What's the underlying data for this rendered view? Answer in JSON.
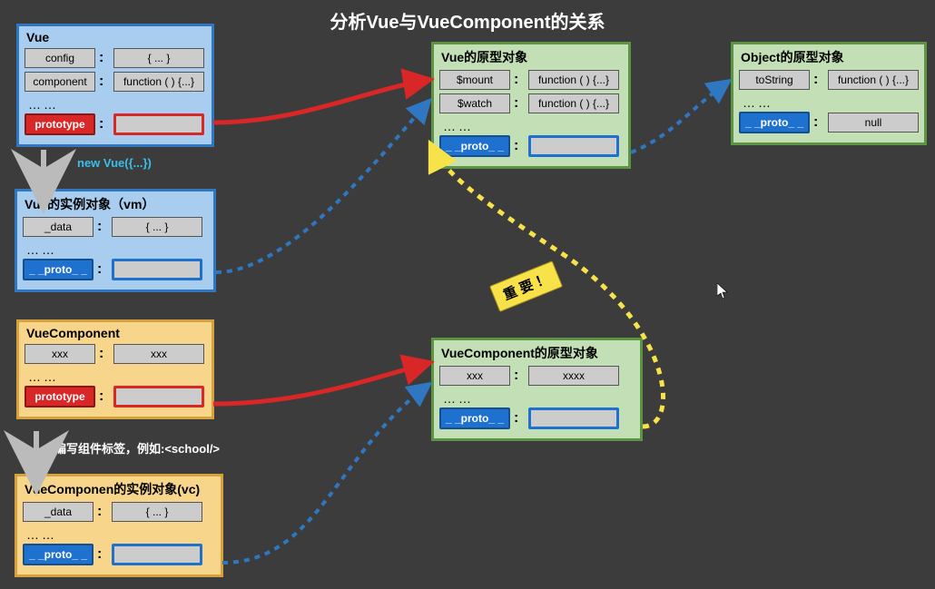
{
  "title": "分析Vue与VueComponent的关系",
  "boxes": {
    "vue": {
      "title": "Vue",
      "rows": [
        {
          "key": "config",
          "val": "{ ... }"
        },
        {
          "key": "component",
          "val": "function ( ) {...}"
        }
      ],
      "dots": "……",
      "proto_label": "prototype"
    },
    "vue_proto": {
      "title": "Vue的原型对象",
      "rows": [
        {
          "key": "$mount",
          "val": "function ( ) {...}"
        },
        {
          "key": "$watch",
          "val": "function ( ) {...}"
        }
      ],
      "dots": "……",
      "proto_label": "_ _proto_ _"
    },
    "obj_proto": {
      "title": "Object的原型对象",
      "rows": [
        {
          "key": "toString",
          "val": "function ( ) {...}"
        }
      ],
      "dots": "……",
      "proto_label": "_ _proto_ _",
      "proto_val": "null"
    },
    "vm": {
      "title": "Vue的实例对象（vm）",
      "rows": [
        {
          "key": "_data",
          "val": "{ ... }"
        }
      ],
      "dots": "……",
      "proto_label": "_ _proto_ _"
    },
    "vc_ctor": {
      "title": "VueComponent",
      "rows": [
        {
          "key": "xxx",
          "val": "xxx"
        }
      ],
      "dots": "……",
      "proto_label": "prototype"
    },
    "vc_proto": {
      "title": "VueComponent的原型对象",
      "rows": [
        {
          "key": "xxx",
          "val": "xxxx"
        }
      ],
      "dots": "……",
      "proto_label": "_ _proto_ _"
    },
    "vc_inst": {
      "title": "VueComponen的实例对象(vc)",
      "rows": [
        {
          "key": "_data",
          "val": "{ ... }"
        }
      ],
      "dots": "……",
      "proto_label": "_ _proto_ _"
    }
  },
  "annotations": {
    "new_vue": "new Vue({...})",
    "write_tag": "编写组件标签，例如:<school/>",
    "important": "重 要 ！"
  }
}
